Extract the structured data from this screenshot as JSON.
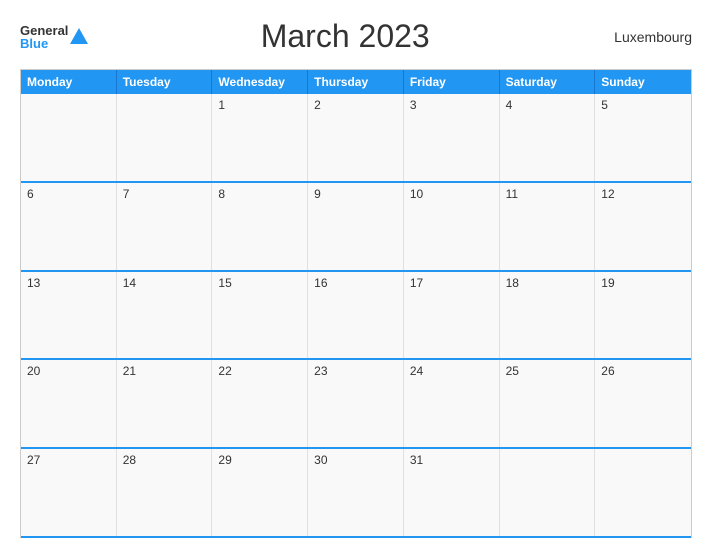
{
  "header": {
    "logo_general": "General",
    "logo_blue": "Blue",
    "title": "March 2023",
    "country": "Luxembourg"
  },
  "weekdays": [
    "Monday",
    "Tuesday",
    "Wednesday",
    "Thursday",
    "Friday",
    "Saturday",
    "Sunday"
  ],
  "weeks": [
    [
      "",
      "",
      "1",
      "2",
      "3",
      "4",
      "5"
    ],
    [
      "6",
      "7",
      "8",
      "9",
      "10",
      "11",
      "12"
    ],
    [
      "13",
      "14",
      "15",
      "16",
      "17",
      "18",
      "19"
    ],
    [
      "20",
      "21",
      "22",
      "23",
      "24",
      "25",
      "26"
    ],
    [
      "27",
      "28",
      "29",
      "30",
      "31",
      "",
      ""
    ]
  ]
}
